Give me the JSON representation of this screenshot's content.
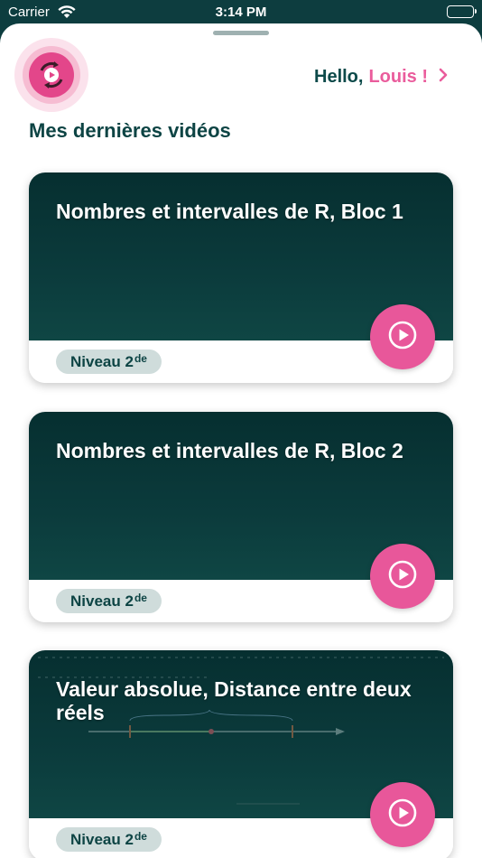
{
  "status_bar": {
    "carrier": "Carrier",
    "time": "3:14 PM"
  },
  "header": {
    "greeting": "Hello,",
    "user_name": "Louis !"
  },
  "section_title": "Mes dernières vidéos",
  "videos": [
    {
      "title": "Nombres et intervalles de R, Bloc 1",
      "level_label": "Niveau 2",
      "level_suffix": "de"
    },
    {
      "title": "Nombres et intervalles de R, Bloc 2",
      "level_label": "Niveau 2",
      "level_suffix": "de"
    },
    {
      "title": "Valeur absolue, Distance entre deux réels",
      "level_label": "Niveau 2",
      "level_suffix": "de"
    }
  ],
  "colors": {
    "primary_dark": "#0d3d3f",
    "accent_pink": "#e8579a",
    "badge_bg": "#cfdcdb"
  },
  "icons": {
    "logo": "video-cycle-logo",
    "greeting_chevron": "chevron-right-icon",
    "play": "play-circle-icon"
  }
}
